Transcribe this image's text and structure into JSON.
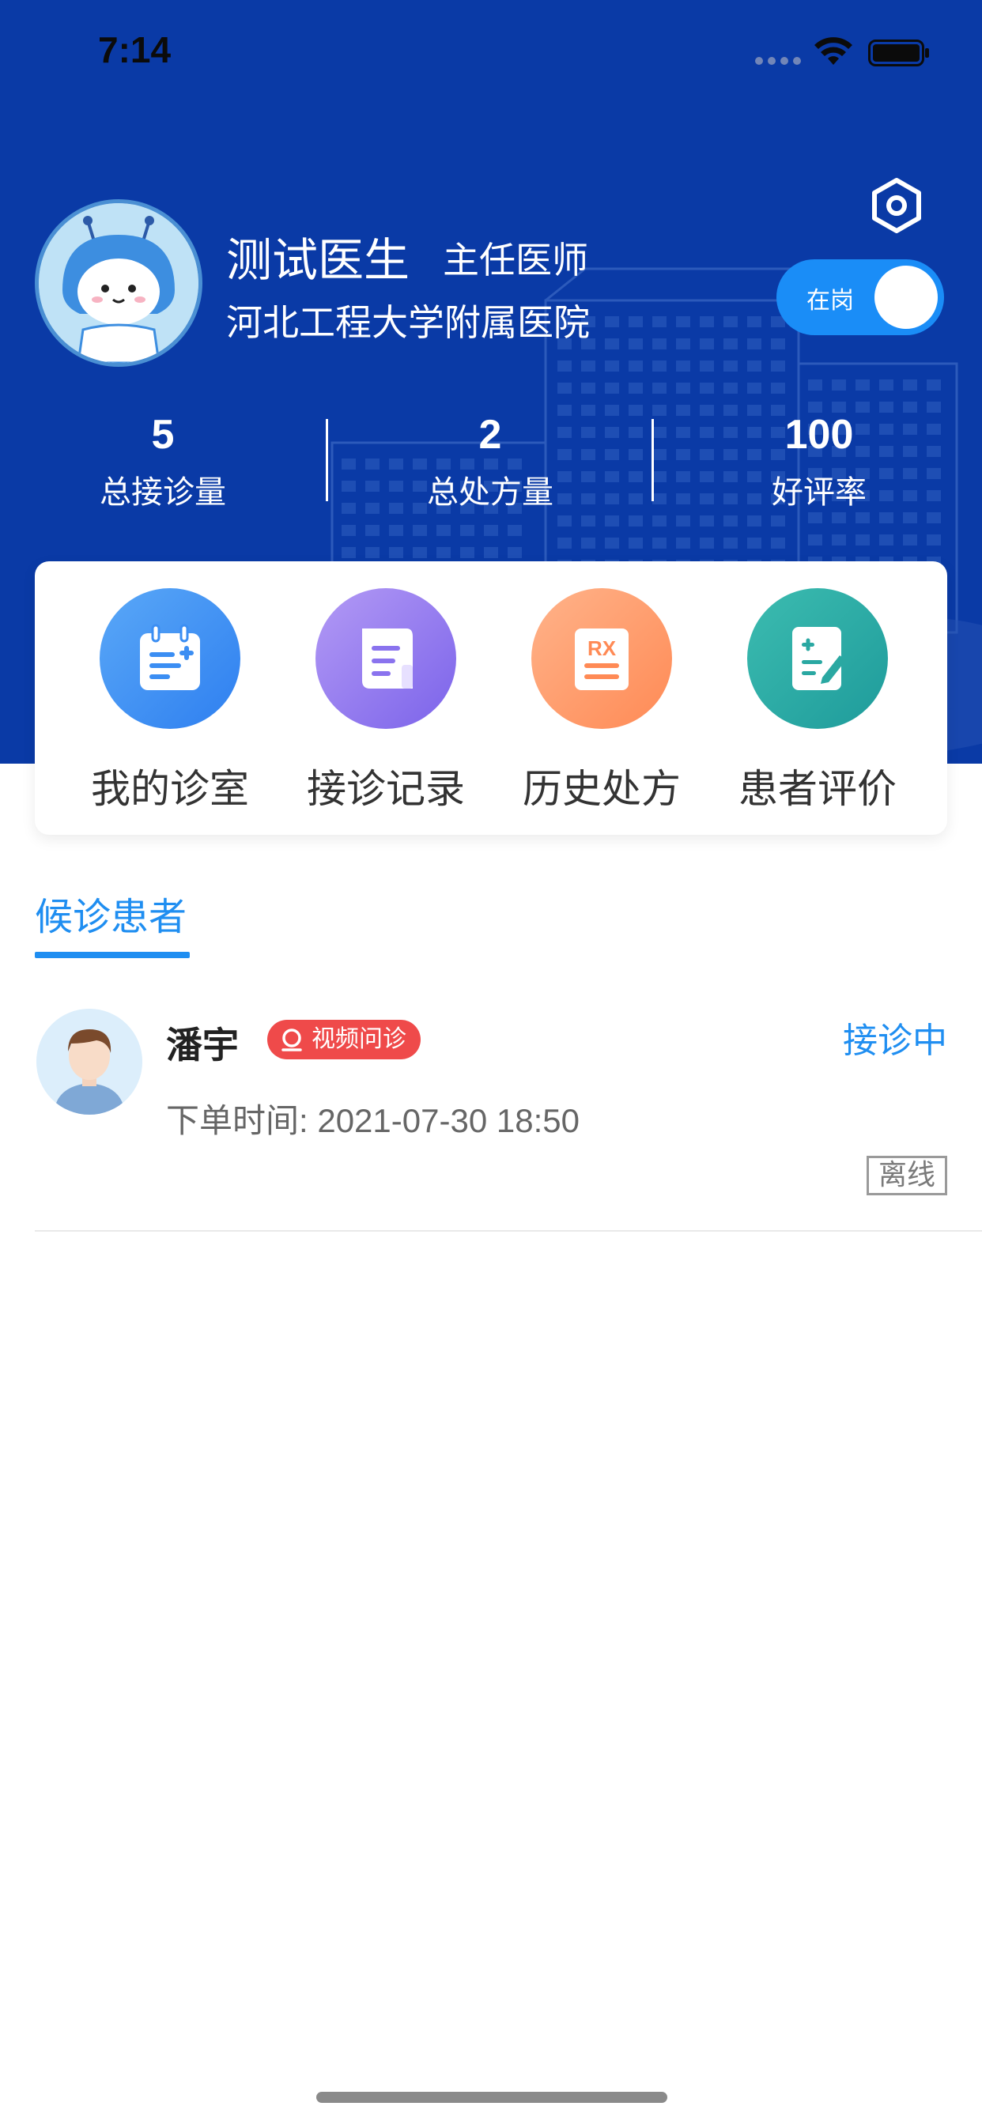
{
  "status_bar": {
    "time": "7:14"
  },
  "profile": {
    "name": "测试医生",
    "title": "主任医师",
    "hospital": "河北工程大学附属医院",
    "duty_label": "在岗",
    "duty_on": true
  },
  "stats": [
    {
      "value": "5",
      "label": "总接诊量"
    },
    {
      "value": "2",
      "label": "总处方量"
    },
    {
      "value": "100",
      "label": "好评率"
    }
  ],
  "actions": [
    {
      "label": "我的诊室",
      "icon": "clinic-calendar-icon",
      "color_from": "#5aa8f7",
      "color_to": "#2e7ff0"
    },
    {
      "label": "接诊记录",
      "icon": "records-scroll-icon",
      "color_from": "#b39af5",
      "color_to": "#7b63ea"
    },
    {
      "label": "历史处方",
      "icon": "rx-icon",
      "color_from": "#ffb38a",
      "color_to": "#ff8a55"
    },
    {
      "label": "患者评价",
      "icon": "review-edit-icon",
      "color_from": "#3cbcb0",
      "color_to": "#1e9b9b"
    }
  ],
  "tabs": {
    "waiting": "候诊患者"
  },
  "patients": [
    {
      "name": "潘宇",
      "consult_type": "视频问诊",
      "status": "接诊中",
      "order_time": "下单时间: 2021-07-30 18:50",
      "online_tag": "离线"
    }
  ],
  "colors": {
    "brand": "#0a3aa6",
    "accent": "#1f8ef1",
    "badge_red": "#ef4a4a"
  }
}
